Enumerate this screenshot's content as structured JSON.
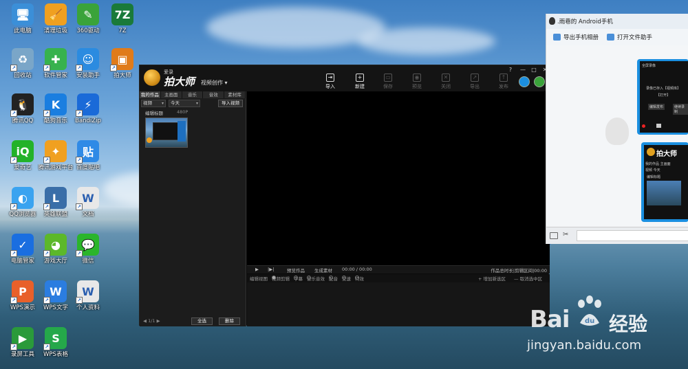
{
  "desktop": {
    "icons": [
      {
        "label": "此电脑",
        "glyph": "🖥",
        "color": "#3b8fd8"
      },
      {
        "label": "清理垃圾",
        "glyph": "🧹",
        "color": "#f0a020"
      },
      {
        "label": "360驱动",
        "glyph": "✎",
        "color": "#3aa33a"
      },
      {
        "label": "7Z",
        "glyph": "7Z",
        "color": "#1a7a3a"
      },
      {
        "label": "回收站",
        "glyph": "♻",
        "color": "#7aa6c8"
      },
      {
        "label": "软件管家",
        "glyph": "✚",
        "color": "#37b24d"
      },
      {
        "label": "安装助手",
        "glyph": "☺",
        "color": "#2b8be0"
      },
      {
        "label": "拍大师",
        "glyph": "▣",
        "color": "#e07b1a"
      },
      {
        "label": "腾讯QQ",
        "glyph": "🐧",
        "color": "#222222"
      },
      {
        "label": "酷狗音乐",
        "glyph": "K",
        "color": "#1a7ee0"
      },
      {
        "label": "BandiZip",
        "glyph": "⚡",
        "color": "#1a6ad8"
      },
      {
        "label": "爱奇艺",
        "glyph": "iQ",
        "color": "#23b229"
      },
      {
        "label": "腾讯游戏平台",
        "glyph": "✦",
        "color": "#f0a020"
      },
      {
        "label": "百度贴吧",
        "glyph": "贴",
        "color": "#2f8ae6"
      },
      {
        "label": "QQ浏览器",
        "glyph": "◐",
        "color": "#3aa3f0"
      },
      {
        "label": "英雄联盟",
        "glyph": "L",
        "color": "#3a6ea8"
      },
      {
        "label": "文档",
        "glyph": "W",
        "color": "#e8e8e8"
      },
      {
        "label": "电脑管家",
        "glyph": "✓",
        "color": "#1a6ee0"
      },
      {
        "label": "游戏大厅",
        "glyph": "◕",
        "color": "#5cb82a"
      },
      {
        "label": "微信",
        "glyph": "💬",
        "color": "#2bb52b"
      },
      {
        "label": "WPS演示",
        "glyph": "P",
        "color": "#e8602a"
      },
      {
        "label": "WPS文字",
        "glyph": "W",
        "color": "#2b7de0"
      },
      {
        "label": "个人资料",
        "glyph": "W",
        "color": "#e8e8e8"
      },
      {
        "label": "录屏工具",
        "glyph": "▶",
        "color": "#2a9a3a"
      },
      {
        "label": "WPS表格",
        "glyph": "S",
        "color": "#25a84a"
      }
    ]
  },
  "app": {
    "logo_small": "爱录",
    "logo_big": "拍大师",
    "mode_label": "视频创作",
    "toolbar": [
      {
        "label": "导入",
        "glyph": "⇥",
        "enabled": true
      },
      {
        "label": "新建",
        "glyph": "+",
        "enabled": true
      },
      {
        "label": "保存",
        "glyph": "▭",
        "enabled": false
      },
      {
        "label": "预览",
        "glyph": "◉",
        "enabled": false
      },
      {
        "label": "关闭",
        "glyph": "✕",
        "enabled": false
      },
      {
        "label": "导出",
        "glyph": "↗",
        "enabled": false
      },
      {
        "label": "发布",
        "glyph": "↑",
        "enabled": false
      }
    ],
    "window_controls": [
      "?",
      "—",
      "□",
      "✕"
    ],
    "tabs": [
      "我的作品",
      "主画面",
      "音乐",
      "音效",
      "素材库"
    ],
    "active_tab": 0,
    "filter_type": "视频",
    "filter_date": "今天",
    "import_video": "导入视频",
    "clip_header": "编辑标题",
    "clip_resolution": "480P",
    "pager": "◀ 1/1 ▶",
    "select_all": "全选",
    "delete": "删除",
    "timeline": {
      "play": "▶",
      "step": "|▶|",
      "preview_work": "预览作品",
      "generate_material": "生成素材",
      "time": "00:00 / 00:00",
      "duration": "作品总时长|剪辑区间|00:00"
    },
    "edit_bar": {
      "label": "编辑视图",
      "options": [
        "视频剪辑",
        "字幕",
        "音乐音效",
        "配音",
        "变速",
        "特效"
      ],
      "selected": 0,
      "add_range": "+ 增加新选区",
      "cancel_range": "— 取消选中区"
    }
  },
  "chat": {
    "title": ".雨巷的 Android手机",
    "export_album": "导出手机相册",
    "open_file_helper": "打开文件助手",
    "bubble1_lines": [
      "全屏录像",
      "录像已存入【视频库】",
      "【打开】",
      "编辑发布",
      "继续录制"
    ],
    "bubble2_logo": "拍大师",
    "bubble2_tabs": "我的作品 主画面",
    "bubble2_filter": "视频  今天",
    "bubble2_clip": "编辑标题"
  },
  "watermark": {
    "brand": "Bai",
    "paw": "du",
    "jingyan": "经验",
    "url": "jingyan.baidu.com"
  }
}
